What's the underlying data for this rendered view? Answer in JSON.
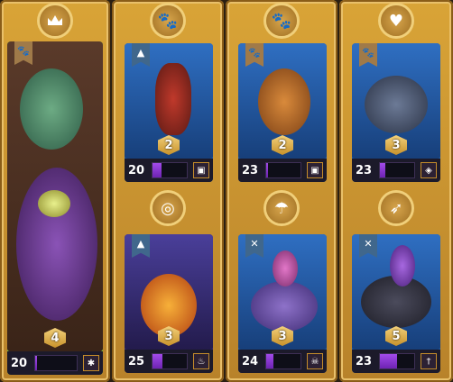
{
  "cards": [
    {
      "id": "big",
      "class_icon": "crown-icon",
      "faction_icon": "paw-icon",
      "stars": "4",
      "level": "20",
      "xp_fill": 0.05,
      "item_icon": "bug-icon",
      "theme": "green"
    },
    {
      "id": "c1",
      "class_icon": "paw-icon",
      "faction_icon": "wolf-icon",
      "stars": "2",
      "level": "20",
      "xp_fill": 0.25,
      "item_icon": "chest-icon",
      "theme": "blue"
    },
    {
      "id": "c2",
      "class_icon": "paw-icon",
      "faction_icon": "paw-icon",
      "stars": "2",
      "level": "23",
      "xp_fill": 0.05,
      "item_icon": "chest-icon",
      "theme": "blue"
    },
    {
      "id": "c3",
      "class_icon": "heart-icon",
      "faction_icon": "paw-icon",
      "stars": "3",
      "level": "23",
      "xp_fill": 0.15,
      "item_icon": "helmet-icon",
      "theme": "blue"
    },
    {
      "id": "c4",
      "class_icon": "spiral-icon",
      "faction_icon": "wolf-icon",
      "stars": "3",
      "level": "25",
      "xp_fill": 0.3,
      "item_icon": "fire-icon",
      "theme": "purple"
    },
    {
      "id": "c5",
      "class_icon": "parachute-icon",
      "faction_icon": "shield-icon",
      "stars": "3",
      "level": "24",
      "xp_fill": 0.2,
      "item_icon": "skull-icon",
      "theme": "blue"
    },
    {
      "id": "c6",
      "class_icon": "wing-icon",
      "faction_icon": "shield-icon",
      "stars": "5",
      "level": "23",
      "xp_fill": 0.5,
      "item_icon": "dagger-icon",
      "theme": "blue"
    }
  ],
  "colors": {
    "frame": "#d9a437",
    "xp": "#8f3bd9"
  }
}
